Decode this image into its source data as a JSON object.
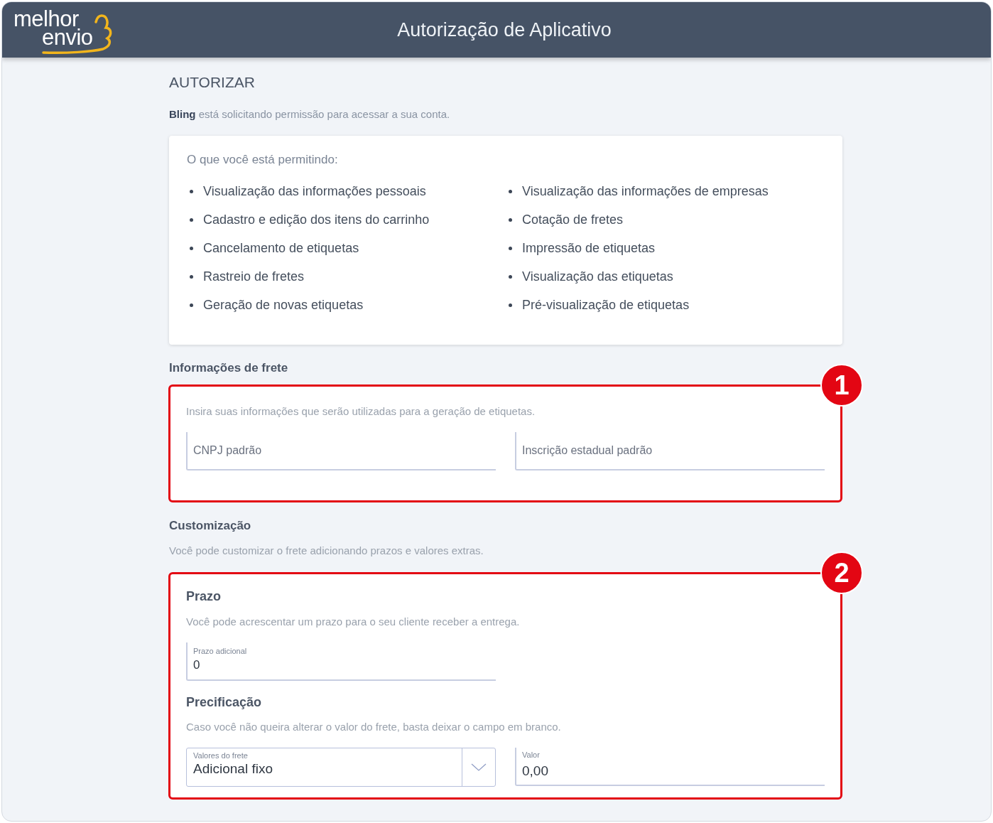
{
  "header": {
    "logo": [
      "melhor",
      "envio"
    ],
    "title": "Autorização de Aplicativo"
  },
  "authorize": {
    "heading": "AUTORIZAR",
    "request_text": "**Bling** está solicitando permissão para acessar a sua conta."
  },
  "permissions": {
    "title": "O que você está permitindo:",
    "columns": [
      [
        "Visualização das informações pessoais",
        "Cadastro e edição dos itens do carrinho",
        "Cancelamento de etiquetas",
        "Rastreio de fretes",
        "Geração de novas etiquetas"
      ],
      [
        "Visualização das informações de empresas",
        "Cotação de fretes",
        "Impressão de etiquetas",
        "Visualização das etiquetas",
        "Pré-visualização de etiquetas"
      ]
    ]
  },
  "shipping_info": {
    "title": "Informações de frete",
    "annotation": "1",
    "description": "Insira suas informações que serão utilizadas para a geração de etiquetas.",
    "fields": [
      {
        "placeholder": "CNPJ padrão"
      },
      {
        "placeholder": "Inscrição estadual padrão"
      }
    ]
  },
  "customization": {
    "title": "Customização",
    "description": "Você pode customizar o frete adicionando prazos e valores extras.",
    "annotation": "2",
    "deadline": {
      "title": "Prazo",
      "description": "Você pode acrescentar um prazo para o seu cliente receber a entrega.",
      "field": {
        "label": "Prazo adicional",
        "value": "0"
      }
    },
    "pricing": {
      "title": "Precificação",
      "description": "Caso você não queira alterar o valor do frete, basta deixar o campo em branco.",
      "select": {
        "label": "Valores do frete",
        "value": "Adicional fixo"
      },
      "field": {
        "label": "Valor",
        "value": "0,00"
      }
    }
  }
}
